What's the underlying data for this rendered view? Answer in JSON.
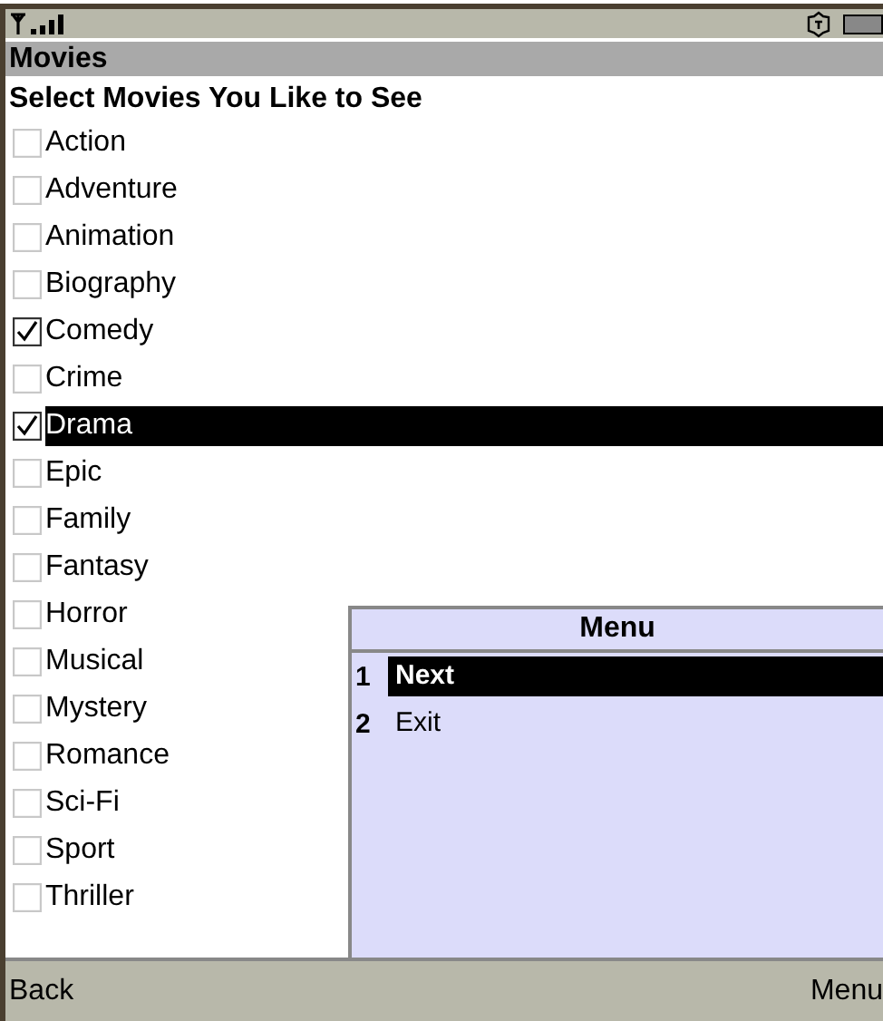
{
  "title": "Movies",
  "heading": "Select Movies You Like to See",
  "genres": [
    {
      "label": "Action",
      "checked": false,
      "selected": false
    },
    {
      "label": "Adventure",
      "checked": false,
      "selected": false
    },
    {
      "label": "Animation",
      "checked": false,
      "selected": false
    },
    {
      "label": "Biography",
      "checked": false,
      "selected": false
    },
    {
      "label": "Comedy",
      "checked": true,
      "selected": false
    },
    {
      "label": "Crime",
      "checked": false,
      "selected": false
    },
    {
      "label": "Drama",
      "checked": true,
      "selected": true
    },
    {
      "label": "Epic",
      "checked": false,
      "selected": false
    },
    {
      "label": "Family",
      "checked": false,
      "selected": false
    },
    {
      "label": "Fantasy",
      "checked": false,
      "selected": false
    },
    {
      "label": "Horror",
      "checked": false,
      "selected": false
    },
    {
      "label": "Musical",
      "checked": false,
      "selected": false
    },
    {
      "label": "Mystery",
      "checked": false,
      "selected": false
    },
    {
      "label": "Romance",
      "checked": false,
      "selected": false
    },
    {
      "label": "Sci-Fi",
      "checked": false,
      "selected": false
    },
    {
      "label": "Sport",
      "checked": false,
      "selected": false
    },
    {
      "label": "Thriller",
      "checked": false,
      "selected": false
    }
  ],
  "menu": {
    "title": "Menu",
    "items": [
      {
        "number": "1",
        "label": "Next",
        "selected": true
      },
      {
        "number": "2",
        "label": "Exit",
        "selected": false
      }
    ]
  },
  "softkeys": {
    "left": "Back",
    "right": "Menu"
  }
}
